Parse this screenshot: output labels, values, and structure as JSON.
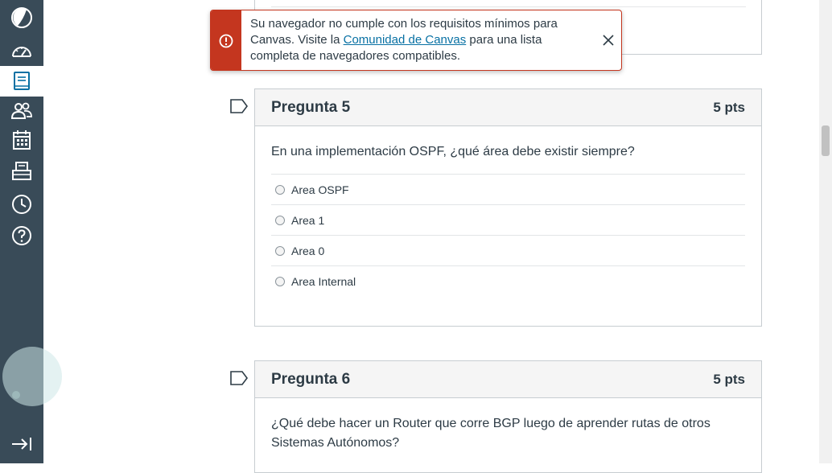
{
  "sidebar": {
    "items": [
      {
        "icon": "account-avatar-icon"
      },
      {
        "icon": "dashboard-icon"
      },
      {
        "icon": "courses-icon"
      },
      {
        "icon": "groups-icon"
      },
      {
        "icon": "calendar-icon"
      },
      {
        "icon": "inbox-icon"
      },
      {
        "icon": "history-icon"
      },
      {
        "icon": "help-icon"
      }
    ],
    "collapse_icon": "collapse-nav-icon",
    "colors": {
      "background": "#394b58",
      "active": "#ffffff",
      "icon": "#ffffff",
      "active_icon": "#0770a3"
    }
  },
  "alert": {
    "text_before": "Su navegador no cumple con los requisitos mínimos para Canvas. Visite la ",
    "link_text": "Comunidad de Canvas",
    "text_after": " para una lista completa de navegadores compatibles.",
    "icon": "warning-icon",
    "close_icon": "close-icon",
    "color": "#c4361f"
  },
  "questions": [
    {
      "title": "Pregunta 5",
      "points": "5 pts",
      "text": "En una implementación OSPF, ¿qué área debe existir siempre?",
      "answers": [
        "Area OSPF",
        "Area 1",
        "Area 0",
        "Area Internal"
      ]
    },
    {
      "title": "Pregunta 6",
      "points": "5 pts",
      "text": "¿Qué debe hacer un Router que corre BGP luego de aprender rutas de otros Sistemas Autónomos?",
      "answers": []
    }
  ]
}
